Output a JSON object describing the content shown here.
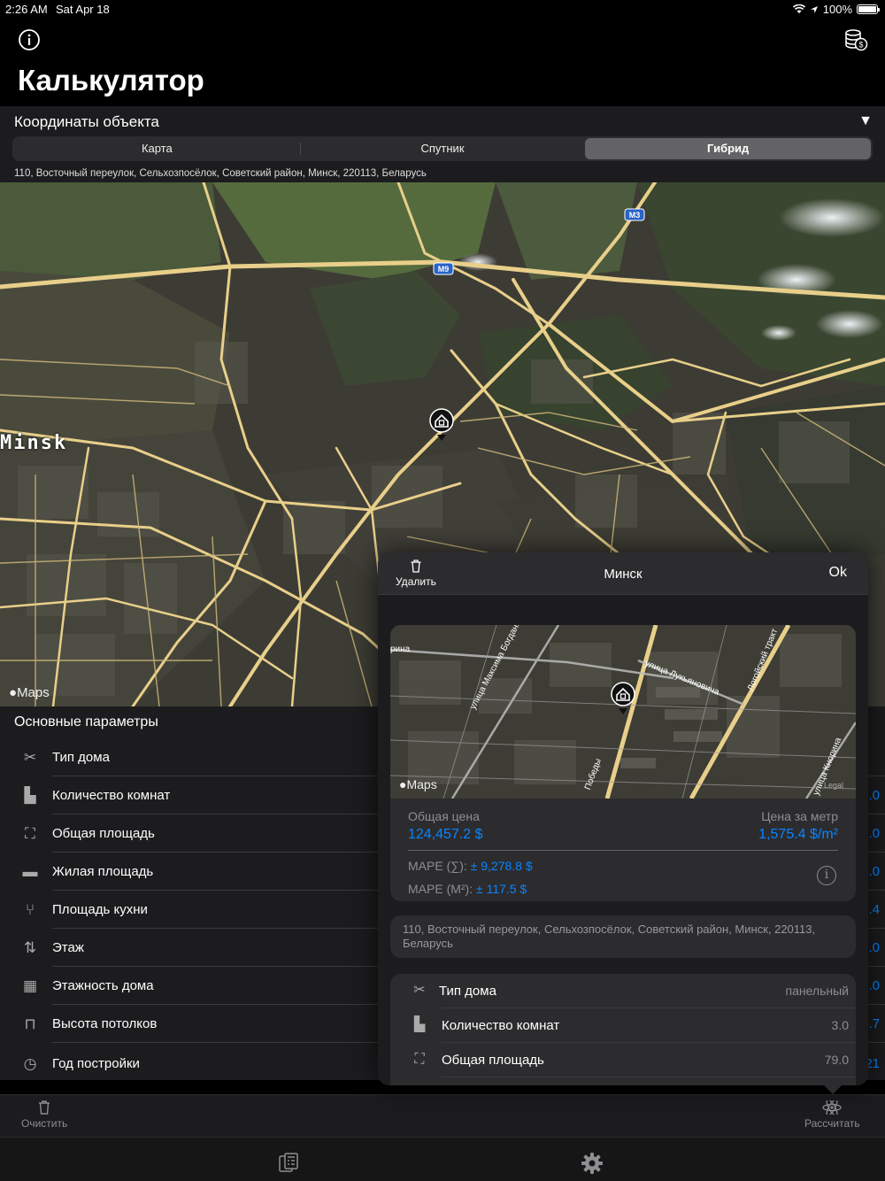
{
  "status_bar": {
    "time": "2:26 AM",
    "date": "Sat Apr 18",
    "battery": "100%"
  },
  "header": {
    "title": "Калькулятор",
    "left_icon": "info-icon",
    "right_icon": "coins-icon"
  },
  "coords_section": {
    "title": "Координаты объекта",
    "segments": [
      "Карта",
      "Спутник",
      "Гибрид"
    ],
    "selected_segment": "Гибрид",
    "address": "110, Восточный переулок, Сельхозпосёлок, Советский район, Минск, 220113, Беларусь"
  },
  "map": {
    "city_label": "Minsk",
    "road_labels": [
      "M3",
      "M9"
    ],
    "attribution": "Maps"
  },
  "params_section": {
    "title": "Основные параметры",
    "rows": [
      {
        "icon": "tools-icon",
        "label": "Тип дома",
        "value": ""
      },
      {
        "icon": "door-icon",
        "label": "Количество комнат",
        "value": ".0"
      },
      {
        "icon": "area-icon",
        "label": "Общая площадь",
        "value": ".0"
      },
      {
        "icon": "sofa-icon",
        "label": "Жилая площадь",
        "value": ".0"
      },
      {
        "icon": "fork-knife-icon",
        "label": "Площадь кухни",
        "value": ".4"
      },
      {
        "icon": "floor-icon",
        "label": "Этаж",
        "value": ".0"
      },
      {
        "icon": "building-icon",
        "label": "Этажность дома",
        "value": ".0"
      },
      {
        "icon": "ceiling-icon",
        "label": "Высота потолков",
        "value": ".7"
      },
      {
        "icon": "clock-icon",
        "label": "Год постройки",
        "value": "21"
      }
    ]
  },
  "toolbar": {
    "clear_label": "Очистить",
    "calculate_label": "Рассчитать"
  },
  "tabbar": {
    "tabs": [
      "calculator-tab-icon",
      "settings-tab-icon"
    ]
  },
  "popover": {
    "delete_label": "Удалить",
    "title": "Минск",
    "ok_label": "Ok",
    "mini_map": {
      "street_labels": [
        "улица Максима Богдановича",
        "улица Лукьяновича",
        "Логойский тракт",
        "улица Кнорина",
        "рина",
        "Победы"
      ],
      "attribution": "Maps",
      "legal": "Legal"
    },
    "price": {
      "total_label": "Общая цена",
      "total_value": "124,457.2 $",
      "per_meter_label": "Цена за метр",
      "per_meter_value": "1,575.4 $/m²",
      "mape_total_label": "MAPE (∑):",
      "mape_total_value": "± 9,278.8 $",
      "mape_m2_label": "MAPE (M²):",
      "mape_m2_value": "± 117.5 $"
    },
    "address": "110, Восточный переулок, Сельхозпосёлок, Советский район, Минск, 220113, Беларусь",
    "details": [
      {
        "icon": "tools-icon",
        "label": "Тип дома",
        "value": "панельный"
      },
      {
        "icon": "door-icon",
        "label": "Количество комнат",
        "value": "3.0"
      },
      {
        "icon": "area-icon",
        "label": "Общая площадь",
        "value": "79.0"
      }
    ]
  },
  "colors": {
    "accent": "#0a84ff",
    "road": "#e8cf8a",
    "background": "#000000",
    "panel": "#1c1c1e"
  }
}
